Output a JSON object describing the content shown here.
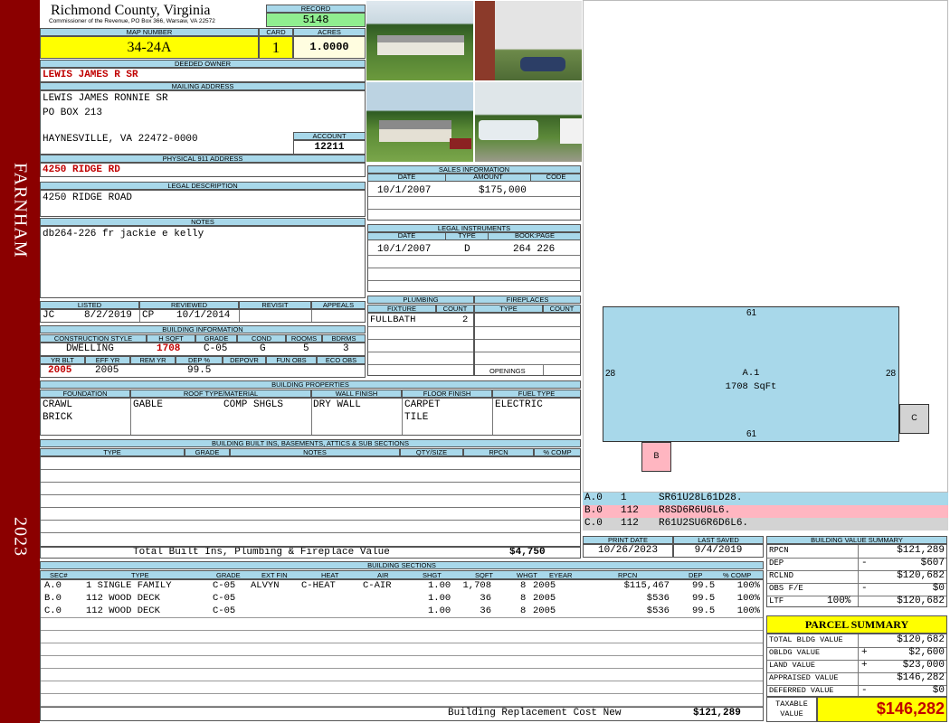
{
  "sidebar": {
    "district": "FARNHAM",
    "year": "2023"
  },
  "header": {
    "county": "Richmond County, Virginia",
    "subtitle": "Commissioner of the Revenue, PO Box 366, Warsaw, VA 22572",
    "record_label": "RECORD",
    "record": "5148",
    "map_label": "MAP NUMBER",
    "map_number": "34-24A",
    "card_label": "CARD",
    "card": "1",
    "acres_label": "ACRES",
    "acres": "1.0000"
  },
  "owner": {
    "deeded_label": "DEEDED OWNER",
    "deeded": "LEWIS JAMES R SR",
    "mailing_label": "MAILING ADDRESS",
    "mailing": [
      "LEWIS JAMES RONNIE SR",
      "PO BOX 213",
      "",
      "HAYNESVILLE, VA 22472-0000"
    ],
    "account_label": "ACCOUNT",
    "account": "12211",
    "physical_label": "PHYSICAL 911 ADDRESS",
    "physical": "4250 RIDGE RD",
    "legal_label": "LEGAL DESCRIPTION",
    "legal": "4250 RIDGE ROAD",
    "notes_label": "NOTES",
    "notes": "db264-226 fr jackie e kelly"
  },
  "sales": {
    "label": "SALES INFORMATION",
    "headers": [
      "DATE",
      "AMOUNT",
      "CODE"
    ],
    "rows": [
      {
        "date": "10/1/2007",
        "amount": "$175,000",
        "code": ""
      }
    ]
  },
  "legal_instruments": {
    "label": "LEGAL INSTRUMENTS",
    "headers": [
      "DATE",
      "TYPE",
      "BOOK:PAGE"
    ],
    "rows": [
      {
        "date": "10/1/2007",
        "type": "D",
        "bookpage": "264 226"
      }
    ]
  },
  "listing": {
    "listed_label": "LISTED",
    "reviewed_label": "REVIEWED",
    "revisit_label": "REVISIT",
    "appeals_label": "APPEALS",
    "listed_by": "JC",
    "listed_date": "8/2/2019",
    "reviewed_by": "CP",
    "reviewed_date": "10/1/2014"
  },
  "building_info": {
    "label": "BUILDING INFORMATION",
    "headers": [
      "CONSTRUCTION STYLE",
      "H SQFT",
      "GRADE",
      "COND",
      "ROOMS",
      "BDRMS"
    ],
    "style": "DWELLING",
    "hsqft": "1708",
    "grade": "C-05",
    "cond": "G",
    "rooms": "5",
    "bdrms": "3",
    "headers2": [
      "YR BLT",
      "EFF YR",
      "REM YR",
      "DEP %",
      "DEPOVR",
      "FUN OBS",
      "ECO OBS"
    ],
    "yrblt": "2005",
    "effyr": "2005",
    "dep": "99.5"
  },
  "plumbing": {
    "label": "PLUMBING",
    "headers": [
      "FIXTURE",
      "COUNT"
    ],
    "rows": [
      {
        "fixture": "FULLBATH",
        "count": "2"
      }
    ]
  },
  "fireplaces": {
    "label": "FIREPLACES",
    "headers": [
      "TYPE",
      "COUNT"
    ],
    "openings_label": "OPENINGS"
  },
  "building_properties": {
    "label": "BUILDING PROPERTIES",
    "headers": [
      "FOUNDATION",
      "ROOF TYPE/MATERIAL",
      "WALL FINISH",
      "FLOOR FINISH",
      "FUEL TYPE"
    ],
    "foundation": [
      "CRAWL",
      "BRICK"
    ],
    "roof_type": "GABLE",
    "roof_material": "COMP SHGLS",
    "wall": "DRY WALL",
    "floor": [
      "CARPET",
      "TILE"
    ],
    "fuel": "ELECTRIC"
  },
  "built_ins": {
    "label": "BUILDING BUILT INS, BASEMENTS, ATTICS & SUB SECTIONS",
    "headers": [
      "TYPE",
      "GRADE",
      "NOTES",
      "QTY/SIZE",
      "RPCN",
      "% COMP"
    ],
    "total_label": "Total Built Ins, Plumbing & Fireplace Value",
    "total": "$4,750"
  },
  "sketch": {
    "main_label": "A.1",
    "main_sqft": "1708 SqFt",
    "dim_top": "61",
    "dim_bottom": "61",
    "dim_left": "28",
    "dim_right": "28",
    "b_label": "B",
    "c_label": "C",
    "vectors": [
      {
        "sec": "A.0",
        "code": "1",
        "vector": "SR61U28L61D28.",
        "color": "#a8d8ea"
      },
      {
        "sec": "B.0",
        "code": "112",
        "vector": "R8SD6R6U6L6.",
        "color": "#ffb6c1"
      },
      {
        "sec": "C.0",
        "code": "112",
        "vector": "R61U2SU6R6D6L6.",
        "color": "#d3d3d3"
      }
    ]
  },
  "dates": {
    "print_label": "PRINT DATE",
    "print": "10/26/2023",
    "saved_label": "LAST SAVED",
    "saved": "9/4/2019"
  },
  "building_sections": {
    "label": "BUILDING SECTIONS",
    "headers": [
      "SEC#",
      "TYPE",
      "GRADE",
      "EXT FIN",
      "HEAT",
      "AIR",
      "SHGT",
      "SQFT",
      "WHGT",
      "EYEAR",
      "RPCN",
      "DEP",
      "% COMP"
    ],
    "rows": [
      {
        "sec": "A.0",
        "type": "1 SINGLE FAMILY",
        "grade": "C-05",
        "ext": "ALVYN",
        "heat": "C-HEAT",
        "air": "C-AIR",
        "shgt": "1.00",
        "sqft": "1,708",
        "whgt": "8",
        "eyear": "2005",
        "rpcn": "$115,467",
        "dep": "99.5",
        "comp": "100%"
      },
      {
        "sec": "B.0",
        "type": "112 WOOD DECK",
        "grade": "C-05",
        "ext": "",
        "heat": "",
        "air": "",
        "shgt": "1.00",
        "sqft": "36",
        "whgt": "8",
        "eyear": "2005",
        "rpcn": "$536",
        "dep": "99.5",
        "comp": "100%"
      },
      {
        "sec": "C.0",
        "type": "112 WOOD DECK",
        "grade": "C-05",
        "ext": "",
        "heat": "",
        "air": "",
        "shgt": "1.00",
        "sqft": "36",
        "whgt": "8",
        "eyear": "2005",
        "rpcn": "$536",
        "dep": "99.5",
        "comp": "100%"
      }
    ],
    "replacement_label": "Building Replacement Cost New",
    "replacement": "$121,289"
  },
  "value_summary": {
    "label": "BUILDING VALUE SUMMARY",
    "rows": [
      {
        "name": "RPCN",
        "op": "",
        "pct": "",
        "value": "$121,289"
      },
      {
        "name": "DEP",
        "op": "-",
        "pct": "",
        "value": "$607"
      },
      {
        "name": "RCLND",
        "op": "",
        "pct": "",
        "value": "$120,682"
      },
      {
        "name": "OBS F/E",
        "op": "-",
        "pct": "",
        "value": "$0"
      },
      {
        "name": "LTF",
        "op": "",
        "pct": "100%",
        "value": "$120,682"
      }
    ]
  },
  "parcel_summary": {
    "label": "PARCEL SUMMARY",
    "rows": [
      {
        "name": "TOTAL BLDG VALUE",
        "op": "",
        "value": "$120,682"
      },
      {
        "name": "OBLDG VALUE",
        "op": "+",
        "value": "$2,600"
      },
      {
        "name": "LAND VALUE",
        "op": "+",
        "value": "$23,000"
      },
      {
        "name": "APPRAISED VALUE",
        "op": "",
        "value": "$146,282"
      },
      {
        "name": "DEFERRED VALUE",
        "op": "-",
        "value": "$0"
      }
    ],
    "taxable_label_1": "TAXABLE",
    "taxable_label_2": "VALUE",
    "taxable": "$146,282"
  }
}
